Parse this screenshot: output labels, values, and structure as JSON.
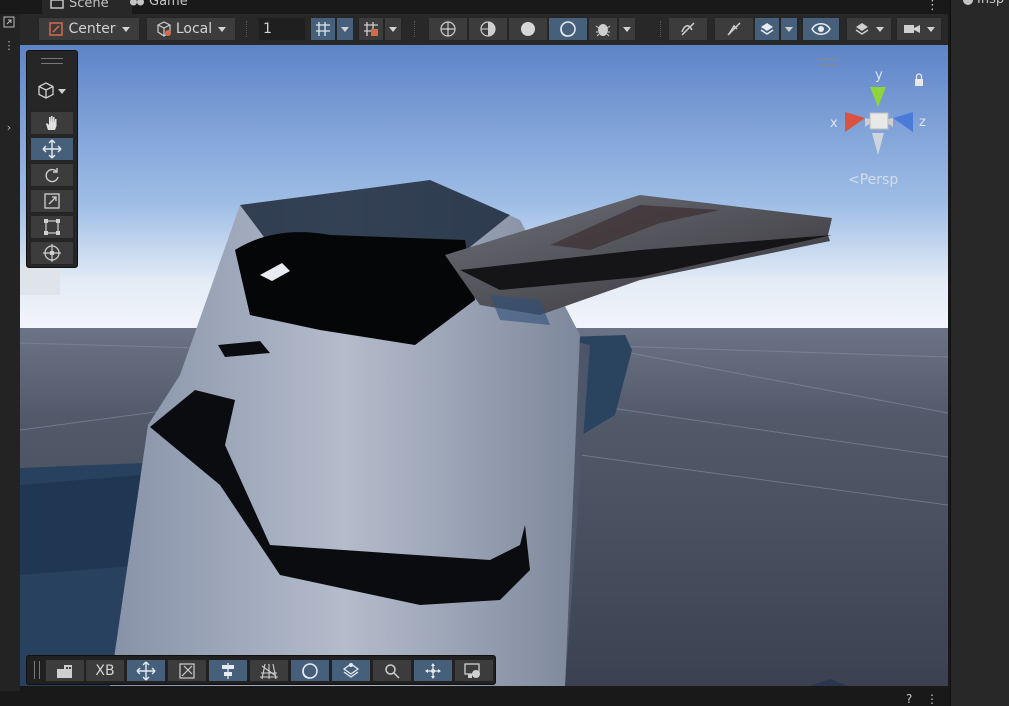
{
  "tabs": [
    {
      "label": "Scene",
      "icon": "scene-icon"
    },
    {
      "label": "Game",
      "icon": "game-controller-icon"
    }
  ],
  "inspector": {
    "tab_label": "Insp"
  },
  "toolbar": {
    "pivot_mode": "Center",
    "pivot_rotation": "Local",
    "snap_increment": "1"
  },
  "orientation_gizmo": {
    "x_label": "x",
    "y_label": "y",
    "z_label": "z",
    "projection_label": "Persp",
    "x_color": "#d9533f",
    "y_color": "#8fd43b",
    "z_color": "#4a7bd6"
  },
  "tools": {
    "active_tool": "move",
    "items": [
      "view",
      "move",
      "rotate",
      "scale",
      "rect",
      "transform"
    ]
  },
  "bottom_overlay": {
    "xb_label": "XB"
  },
  "status": {
    "right_label": "?"
  },
  "colors": {
    "accent": "#46607c",
    "panel": "#282828",
    "button": "#3c3c3c"
  }
}
